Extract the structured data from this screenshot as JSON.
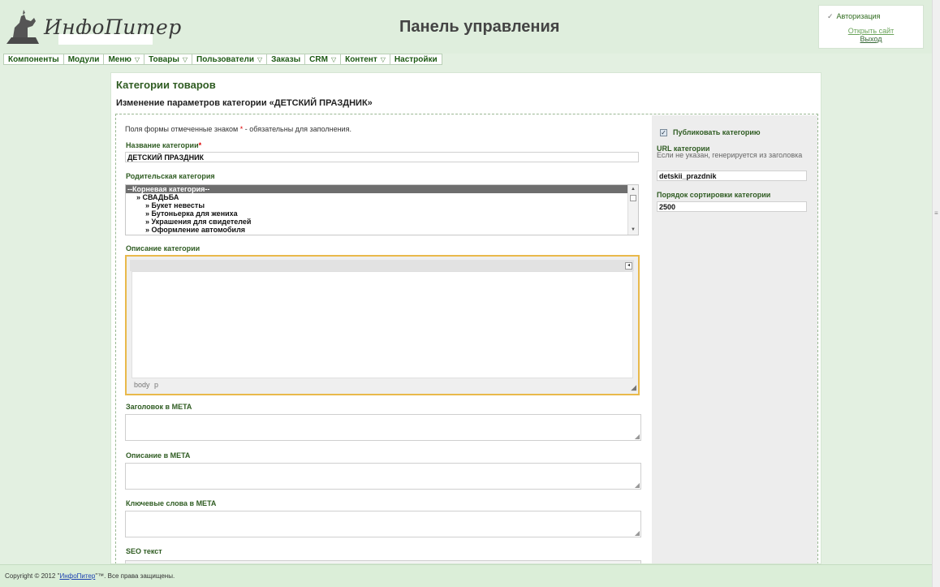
{
  "header": {
    "logo_text": "ИнфоПитер",
    "title": "Панель управления"
  },
  "auth": {
    "title": "Авторизация",
    "open_site": "Открыть сайт",
    "logout": "Выход"
  },
  "nav": {
    "items": [
      {
        "label": "Компоненты",
        "dropdown": false
      },
      {
        "label": "Модули",
        "dropdown": false
      },
      {
        "label": "Меню",
        "dropdown": true
      },
      {
        "label": "Товары",
        "dropdown": true
      },
      {
        "label": "Пользователи",
        "dropdown": true
      },
      {
        "label": "Заказы",
        "dropdown": false
      },
      {
        "label": "CRM",
        "dropdown": true
      },
      {
        "label": "Контент",
        "dropdown": true
      },
      {
        "label": "Настройки",
        "dropdown": false
      }
    ]
  },
  "page": {
    "heading": "Категории товаров",
    "subheading": "Изменение параметров категории «ДЕТСКИЙ ПРАЗДНИК»"
  },
  "form": {
    "note_before": "Поля формы отмеченные знаком",
    "note_star": "*",
    "note_after": "- обязательны для заполнения.",
    "category_name_label": "Название категории",
    "category_name_value": "ДЕТСКИЙ ПРАЗДНИК",
    "parent_label": "Родительская категория",
    "parent_options": [
      "--Корневая категория--",
      "» СВАДЬБА",
      "» Букет невесты",
      "» Бутоньерка для жениха",
      "» Украшения для свидетелей",
      "» Оформление автомобиля"
    ],
    "description_label": "Описание категории",
    "editor_status": "body p",
    "meta_title_label": "Заголовок в META",
    "meta_description_label": "Описание в META",
    "meta_keywords_label": "Ключевые слова в META",
    "seo_text_label": "SEO текст"
  },
  "sidebar": {
    "publish_label": "Публиковать категорию",
    "publish_checked": true,
    "url_label": "URL категории",
    "url_hint": "Если не указан, генерируется из заголовка",
    "url_value": "detskii_prazdnik",
    "sort_label": "Порядок сортировки категории",
    "sort_value": "2500"
  },
  "footer": {
    "prefix": "Copyright © 2012 \"",
    "link": "ИнфоПитер",
    "suffix": "\"™. Все права защищены."
  },
  "colors": {
    "accent_green": "#2f5c22",
    "header_bg": "#dfeedd",
    "editor_focus": "#e9b94b"
  }
}
